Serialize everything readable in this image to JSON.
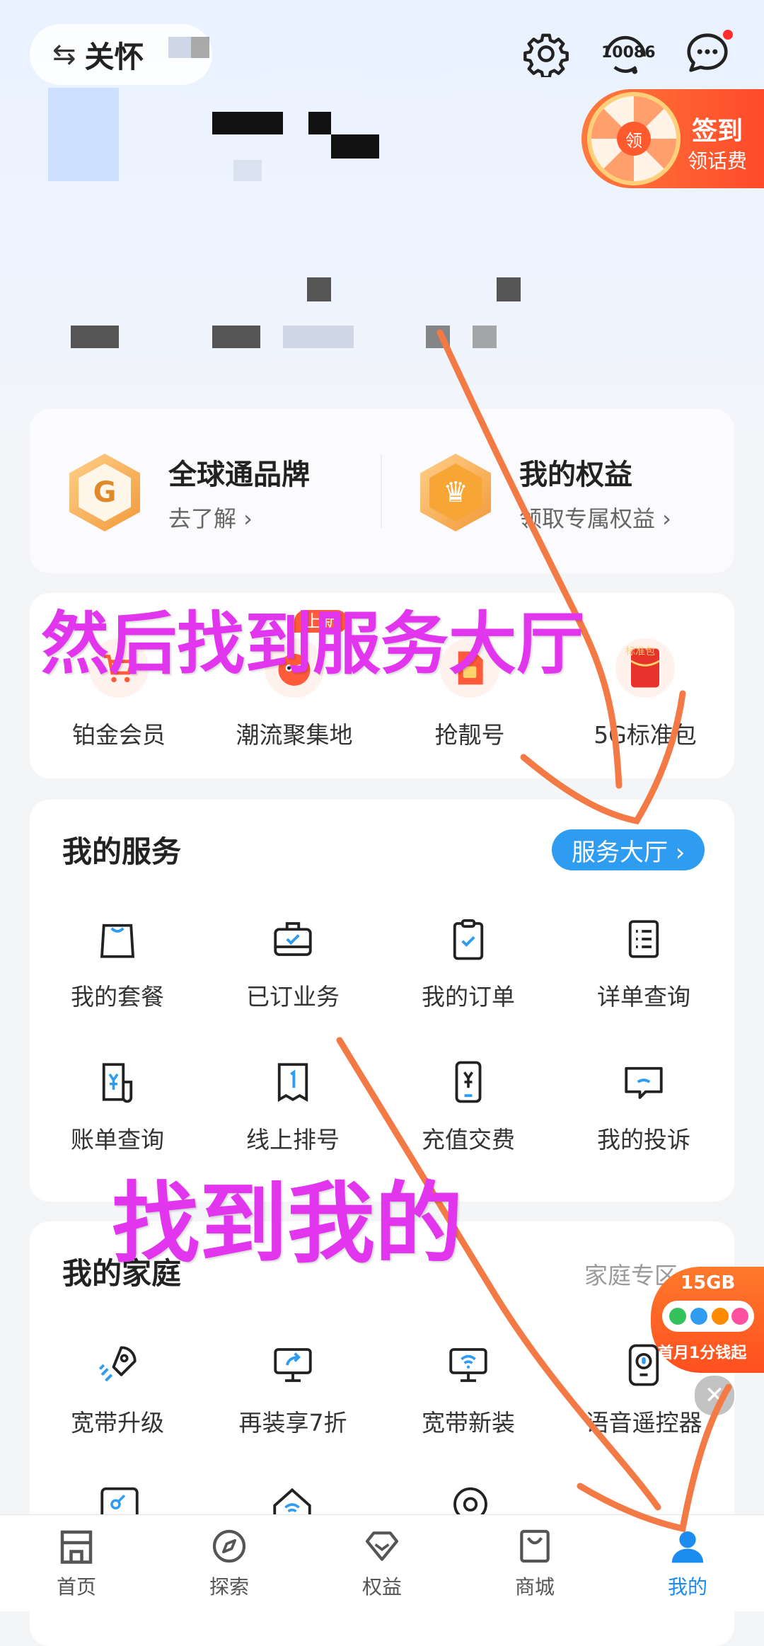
{
  "header": {
    "care_mode_symbol": "⇆",
    "care_mode_label": "关怀",
    "service_number": "10086",
    "signin_title": "签到",
    "signin_subtitle": "领话费",
    "signin_wheel_center": "领"
  },
  "brand_row": [
    {
      "title": "全球通品牌",
      "subtitle": "去了解 ›",
      "icon": "quanqiutong-logo-icon"
    },
    {
      "title": "我的权益",
      "subtitle": "领取专属权益 ›",
      "icon": "crown-icon"
    }
  ],
  "promo": {
    "badge": "上新",
    "items": [
      {
        "label": "铂金会员",
        "icon": "cart-icon"
      },
      {
        "label": "潮流聚集地",
        "icon": "mascot-icon"
      },
      {
        "label": "抢靓号",
        "icon": "sim-card-icon"
      },
      {
        "label": "5G标准包",
        "icon": "red-envelope-icon",
        "icon_text": "标准包"
      }
    ]
  },
  "my_services": {
    "title": "我的服务",
    "hall_button": "服务大厅 ›",
    "items": [
      {
        "label": "我的套餐",
        "icon": "bag-icon"
      },
      {
        "label": "已订业务",
        "icon": "briefcase-check-icon"
      },
      {
        "label": "我的订单",
        "icon": "clipboard-check-icon"
      },
      {
        "label": "详单查询",
        "icon": "list-document-icon"
      },
      {
        "label": "账单查询",
        "icon": "bill-yuan-icon"
      },
      {
        "label": "线上排号",
        "icon": "queue-ticket-icon"
      },
      {
        "label": "充值交费",
        "icon": "phone-yuan-icon"
      },
      {
        "label": "我的投诉",
        "icon": "complaint-chat-icon"
      }
    ]
  },
  "my_family": {
    "title": "我的家庭",
    "more": "家庭专区 ›",
    "items": [
      {
        "label": "宽带升级",
        "icon": "rocket-icon"
      },
      {
        "label": "再装享7折",
        "icon": "monitor-share-icon"
      },
      {
        "label": "宽带新装",
        "icon": "monitor-wifi-icon"
      },
      {
        "label": "语音遥控器",
        "icon": "remote-mic-icon"
      }
    ]
  },
  "float_ad": {
    "capacity": "15GB",
    "text": "首月1分钱起"
  },
  "annotations": {
    "top": "然后找到服务大厅",
    "bottom": "找到我的"
  },
  "tabbar": [
    {
      "label": "首页",
      "icon": "home-store-icon",
      "active": false
    },
    {
      "label": "探索",
      "icon": "compass-icon",
      "active": false
    },
    {
      "label": "权益",
      "icon": "diamond-icon",
      "active": false
    },
    {
      "label": "商城",
      "icon": "shopping-bag-icon",
      "active": false
    },
    {
      "label": "我的",
      "icon": "user-icon",
      "active": true
    }
  ],
  "colors": {
    "accent": "#1d8cf0",
    "annotation": "#e135ee",
    "arrow": "#f47a45",
    "orange": "#ff5b3a"
  }
}
